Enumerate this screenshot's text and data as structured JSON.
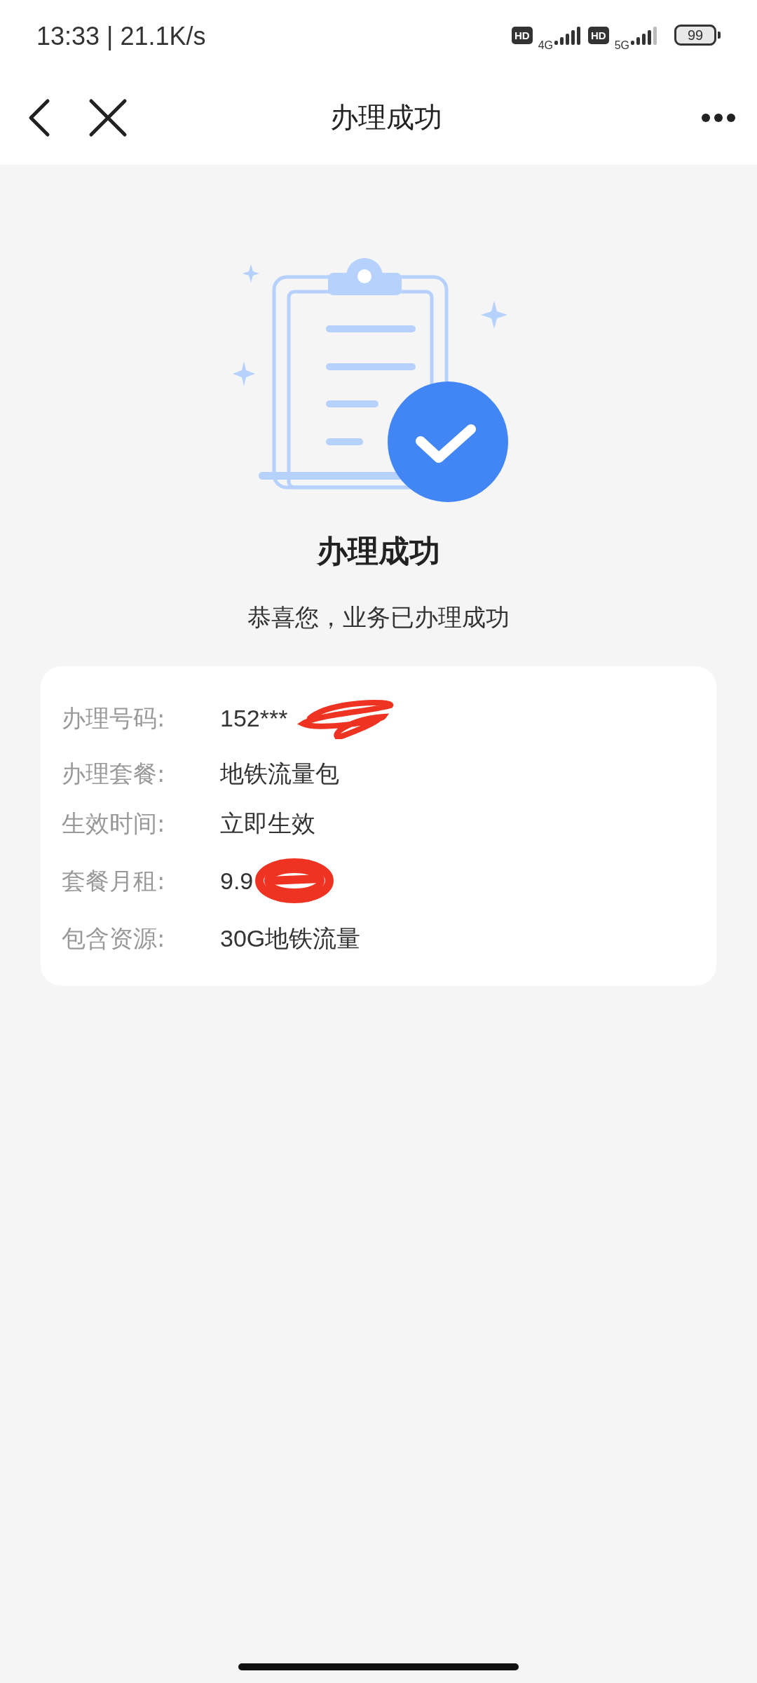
{
  "status_bar": {
    "time": "13:33 | 21.1K/s",
    "sim1": {
      "badge": "HD",
      "network": "4G"
    },
    "sim2": {
      "badge": "HD",
      "network": "5G"
    },
    "battery": "99"
  },
  "nav": {
    "title": "办理成功"
  },
  "result": {
    "title": "办理成功",
    "message": "恭喜您，业务已办理成功"
  },
  "details": [
    {
      "label": "办理号码:",
      "value": "152***",
      "redacted": true
    },
    {
      "label": "办理套餐:",
      "value": "地铁流量包",
      "redacted": false
    },
    {
      "label": "生效时间:",
      "value": "立即生效",
      "redacted": false
    },
    {
      "label": "套餐月租:",
      "value": "9.9",
      "redacted": true
    },
    {
      "label": "包含资源:",
      "value": "30G地铁流量",
      "redacted": false
    }
  ]
}
